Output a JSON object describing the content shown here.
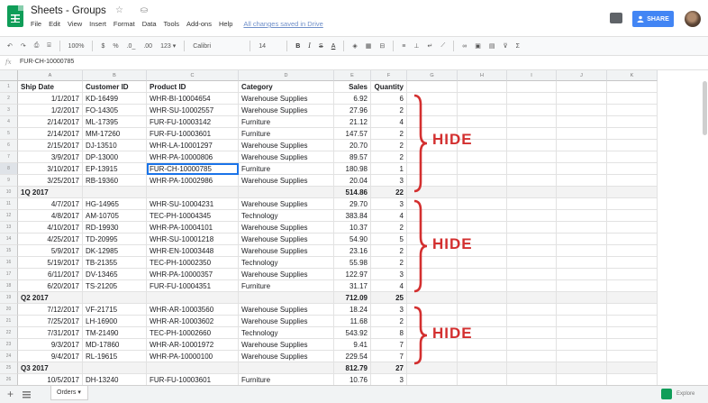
{
  "app": {
    "title": "Sheets - Groups",
    "title_icons": "☆ ⛀",
    "menu": [
      "File",
      "Edit",
      "View",
      "Insert",
      "Format",
      "Data",
      "Tools",
      "Add-ons",
      "Help"
    ],
    "save_status": "All changes saved in Drive",
    "share_label": "SHARE",
    "share_icon": "person-icon",
    "brand_color": "#0f9d58",
    "accent_color": "#4285f4"
  },
  "toolbar": {
    "zoom": "100%",
    "currency": "$",
    "percent": "%",
    "decimals_less": ".0_",
    "decimals_more": ".00",
    "more_formats": "123 ▾",
    "font": "Calibri",
    "font_size": "14",
    "bold": "B",
    "italic": "I",
    "strike": "S",
    "text_color": "A"
  },
  "formula_bar": {
    "fx": "fx",
    "value": "FUR-CH-10000785"
  },
  "grid": {
    "columns": [
      "A",
      "B",
      "C",
      "D",
      "E",
      "F",
      "G",
      "H",
      "I",
      "J",
      "K"
    ],
    "header_row": [
      "Ship Date",
      "Customer ID",
      "Product ID",
      "Category",
      "Sales",
      "Quantity"
    ],
    "rows": [
      {
        "num": "1",
        "type": "header"
      },
      {
        "num": "2",
        "type": "data",
        "cells": [
          "1/1/2017",
          "KD-16499",
          "WHR-BI-10004654",
          "Warehouse Supplies",
          "6.92",
          "6"
        ]
      },
      {
        "num": "3",
        "type": "data",
        "cells": [
          "1/2/2017",
          "FO-14305",
          "WHR-SU-10002557",
          "Warehouse Supplies",
          "27.96",
          "2"
        ]
      },
      {
        "num": "4",
        "type": "data",
        "cells": [
          "2/14/2017",
          "ML-17395",
          "FUR-FU-10003142",
          "Furniture",
          "21.12",
          "4"
        ]
      },
      {
        "num": "5",
        "type": "data",
        "cells": [
          "2/14/2017",
          "MM-17260",
          "FUR-FU-10003601",
          "Furniture",
          "147.57",
          "2"
        ]
      },
      {
        "num": "6",
        "type": "data",
        "cells": [
          "2/15/2017",
          "DJ-13510",
          "WHR-LA-10001297",
          "Warehouse Supplies",
          "20.70",
          "2"
        ]
      },
      {
        "num": "7",
        "type": "data",
        "cells": [
          "3/9/2017",
          "DP-13000",
          "WHR-PA-10000806",
          "Warehouse Supplies",
          "89.57",
          "2"
        ]
      },
      {
        "num": "8",
        "type": "data",
        "cells": [
          "3/10/2017",
          "EP-13915",
          "FUR-CH-10000785",
          "Furniture",
          "180.98",
          "1"
        ],
        "selected": true
      },
      {
        "num": "9",
        "type": "data",
        "cells": [
          "3/25/2017",
          "RB-19360",
          "WHR-PA-10002986",
          "Warehouse Supplies",
          "20.04",
          "3"
        ]
      },
      {
        "num": "10",
        "type": "subtotal",
        "cells": [
          "1Q 2017",
          "",
          "",
          "",
          "514.86",
          "22"
        ]
      },
      {
        "num": "11",
        "type": "data",
        "cells": [
          "4/7/2017",
          "HG-14965",
          "WHR-SU-10004231",
          "Warehouse Supplies",
          "29.70",
          "3"
        ]
      },
      {
        "num": "12",
        "type": "data",
        "cells": [
          "4/8/2017",
          "AM-10705",
          "TEC-PH-10004345",
          "Technology",
          "383.84",
          "4"
        ]
      },
      {
        "num": "13",
        "type": "data",
        "cells": [
          "4/10/2017",
          "RD-19930",
          "WHR-PA-10004101",
          "Warehouse Supplies",
          "10.37",
          "2"
        ]
      },
      {
        "num": "14",
        "type": "data",
        "cells": [
          "4/25/2017",
          "TD-20995",
          "WHR-SU-10001218",
          "Warehouse Supplies",
          "54.90",
          "5"
        ]
      },
      {
        "num": "15",
        "type": "data",
        "cells": [
          "5/9/2017",
          "DK-12985",
          "WHR-EN-10003448",
          "Warehouse Supplies",
          "23.16",
          "2"
        ]
      },
      {
        "num": "16",
        "type": "data",
        "cells": [
          "5/19/2017",
          "TB-21355",
          "TEC-PH-10002350",
          "Technology",
          "55.98",
          "2"
        ]
      },
      {
        "num": "17",
        "type": "data",
        "cells": [
          "6/11/2017",
          "DV-13465",
          "WHR-PA-10000357",
          "Warehouse Supplies",
          "122.97",
          "3"
        ]
      },
      {
        "num": "18",
        "type": "data",
        "cells": [
          "6/20/2017",
          "TS-21205",
          "FUR-FU-10004351",
          "Furniture",
          "31.17",
          "4"
        ]
      },
      {
        "num": "19",
        "type": "subtotal",
        "cells": [
          "Q2 2017",
          "",
          "",
          "",
          "712.09",
          "25"
        ]
      },
      {
        "num": "20",
        "type": "data",
        "cells": [
          "7/12/2017",
          "VF-21715",
          "WHR-AR-10003560",
          "Warehouse Supplies",
          "18.24",
          "3"
        ]
      },
      {
        "num": "21",
        "type": "data",
        "cells": [
          "7/25/2017",
          "LH-16900",
          "WHR-AR-10003602",
          "Warehouse Supplies",
          "11.68",
          "2"
        ]
      },
      {
        "num": "22",
        "type": "data",
        "cells": [
          "7/31/2017",
          "TM-21490",
          "TEC-PH-10002660",
          "Technology",
          "543.92",
          "8"
        ]
      },
      {
        "num": "23",
        "type": "data",
        "cells": [
          "9/3/2017",
          "MD-17860",
          "WHR-AR-10001972",
          "Warehouse Supplies",
          "9.41",
          "7"
        ]
      },
      {
        "num": "24",
        "type": "data",
        "cells": [
          "9/4/2017",
          "RL-19615",
          "WHR-PA-10000100",
          "Warehouse Supplies",
          "229.54",
          "7"
        ]
      },
      {
        "num": "25",
        "type": "subtotal",
        "cells": [
          "Q3 2017",
          "",
          "",
          "",
          "812.79",
          "27"
        ]
      },
      {
        "num": "26",
        "type": "data",
        "cells": [
          "10/5/2017",
          "DH-13240",
          "FUR-FU-10003601",
          "Furniture",
          "10.76",
          "3"
        ]
      }
    ]
  },
  "annotations": {
    "hide_label": "HIDE",
    "color": "#d32f2f"
  },
  "bottom_bar": {
    "add_sheet": "+",
    "sheet_tab": "Orders ▾",
    "explore_label": "Explore"
  }
}
